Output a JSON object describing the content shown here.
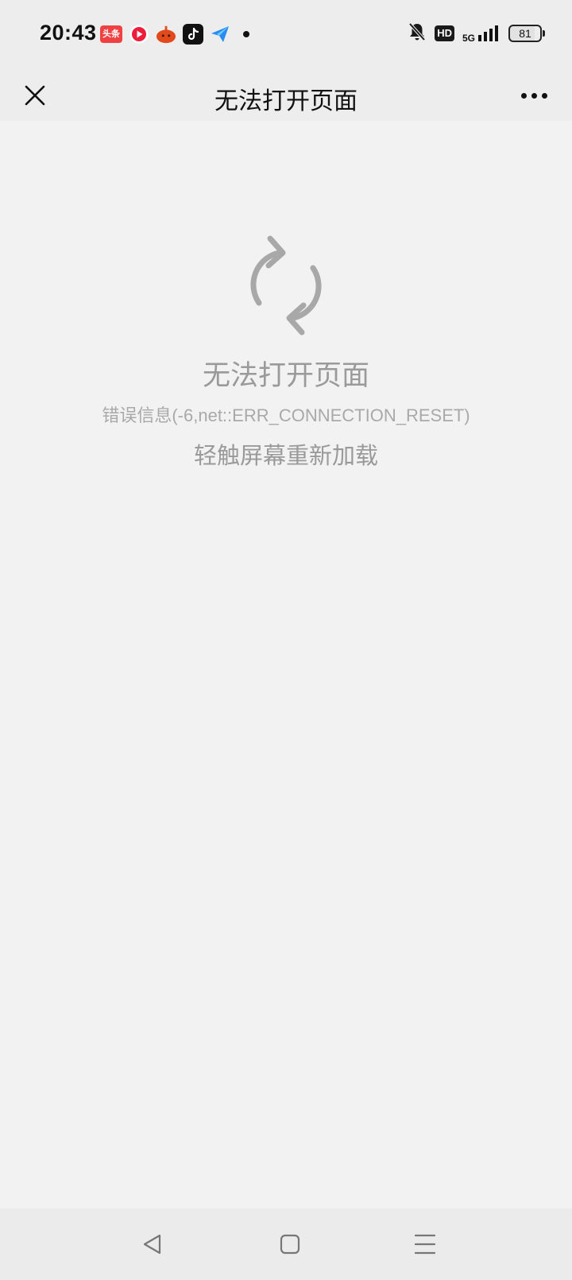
{
  "status_bar": {
    "time": "20:43",
    "notification_icons": [
      "toutiao-icon",
      "music-icon",
      "app-icon",
      "tiktok-icon",
      "paper-plane-icon"
    ],
    "toutiao_label": "头条",
    "hd_label": "HD",
    "network_label": "5G",
    "battery_level": "81"
  },
  "header": {
    "title": "无法打开页面"
  },
  "error": {
    "title": "无法打开页面",
    "info": "错误信息(-6,net::ERR_CONNECTION_RESET)",
    "reload_hint": "轻触屏幕重新加载"
  },
  "colors": {
    "background": "#f2f2f2",
    "header_bg": "#ededed",
    "icon_gray": "#a8a8a8",
    "text_gray": "#9a9a9a"
  }
}
